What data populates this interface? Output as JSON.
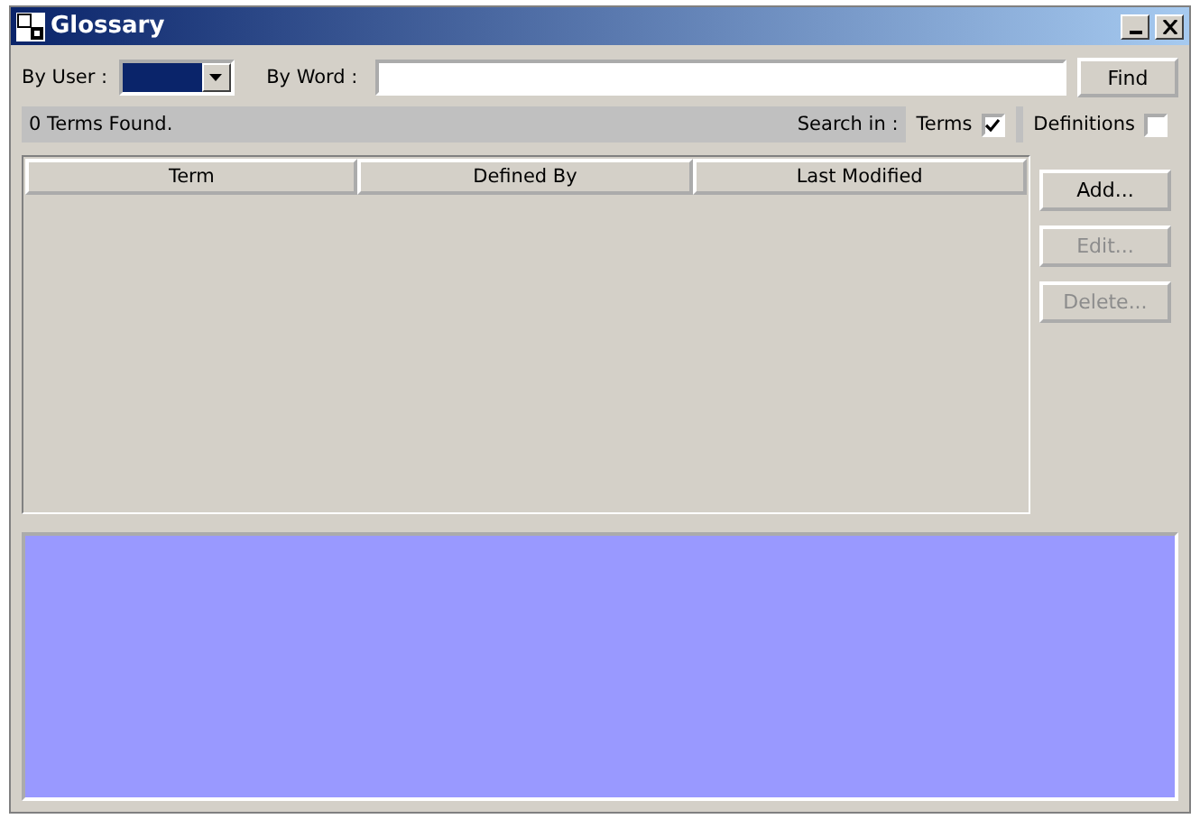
{
  "window": {
    "title": "Glossary"
  },
  "filters": {
    "by_user_label": "By User :",
    "by_word_label": "By Word :",
    "find_button": "Find"
  },
  "status": {
    "found": "0 Terms Found.",
    "search_in_label": "Search in :",
    "options": [
      {
        "label": "Terms",
        "checked": true
      },
      {
        "label": "Definitions",
        "checked": false
      }
    ]
  },
  "table": {
    "columns": [
      "Term",
      "Defined By",
      "Last Modified"
    ]
  },
  "actions": [
    {
      "label": "Add...",
      "disabled": false
    },
    {
      "label": "Edit...",
      "disabled": true
    },
    {
      "label": "Delete...",
      "disabled": true
    }
  ]
}
